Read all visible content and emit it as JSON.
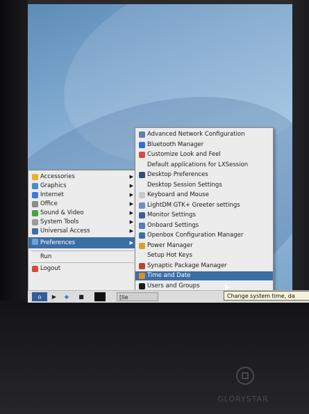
{
  "main_menu": {
    "items": [
      {
        "label": "Accessories",
        "icon": "accessories-icon",
        "color": "#e6b41e",
        "arrow": "▶"
      },
      {
        "label": "Graphics",
        "icon": "graphics-icon",
        "color": "#4b8bd1",
        "arrow": "▶"
      },
      {
        "label": "Internet",
        "icon": "internet-icon",
        "color": "#3a7bd5",
        "arrow": "▶"
      },
      {
        "label": "Office",
        "icon": "office-icon",
        "color": "#8a8a8a",
        "arrow": "▶"
      },
      {
        "label": "Sound & Video",
        "icon": "sound-video-icon",
        "color": "#4aa047",
        "arrow": "▶"
      },
      {
        "label": "System Tools",
        "icon": "system-tools-icon",
        "color": "#9a9a9a",
        "arrow": "▶"
      },
      {
        "label": "Universal Access",
        "icon": "universal-access-icon",
        "color": "#3a6ea5",
        "arrow": "▶"
      },
      {
        "label": "Preferences",
        "icon": "preferences-icon",
        "color": "#6fa0d8",
        "arrow": "▶"
      },
      {
        "label": "Run",
        "icon": "run-icon",
        "color": "#ececec",
        "arrow": ""
      },
      {
        "label": "Logout",
        "icon": "logout-icon",
        "color": "#d94a3a",
        "arrow": ""
      }
    ],
    "active_item": "Preferences"
  },
  "sub_menu": {
    "items": [
      {
        "label": "Advanced Network Configuration",
        "icon": "network-config-icon",
        "color": "#5a7fb0"
      },
      {
        "label": "Bluetooth Manager",
        "icon": "bluetooth-icon",
        "color": "#2f6fd6"
      },
      {
        "label": "Customize Look and Feel",
        "icon": "look-feel-icon",
        "color": "#d64a4a"
      },
      {
        "label": "Default applications for LXSession",
        "icon": "default-apps-icon",
        "color": "#ececec"
      },
      {
        "label": "Desktop Preferences",
        "icon": "desktop-prefs-icon",
        "color": "#2f4f7a"
      },
      {
        "label": "Desktop Session Settings",
        "icon": "session-settings-icon",
        "color": "#ececec"
      },
      {
        "label": "Keyboard and Mouse",
        "icon": "keyboard-mouse-icon",
        "color": "#c9c9c9"
      },
      {
        "label": "LightDM GTK+ Greeter settings",
        "icon": "greeter-icon",
        "color": "#6c8fbd"
      },
      {
        "label": "Monitor Settings",
        "icon": "monitor-icon",
        "color": "#3a5f95"
      },
      {
        "label": "Onboard Settings",
        "icon": "onboard-icon",
        "color": "#4d7fc0"
      },
      {
        "label": "Openbox Configuration Manager",
        "icon": "openbox-icon",
        "color": "#3a6ea5"
      },
      {
        "label": "Power Manager",
        "icon": "power-icon",
        "color": "#d8a02a"
      },
      {
        "label": "Setup Hot Keys",
        "icon": "hotkeys-icon",
        "color": "#ececec"
      },
      {
        "label": "Synaptic Package Manager",
        "icon": "synaptic-icon",
        "color": "#b3472f"
      },
      {
        "label": "Time and Date",
        "icon": "time-date-icon",
        "color": "#e08a2a"
      },
      {
        "label": "Users and Groups",
        "icon": "users-groups-icon",
        "color": "#1a1a1a"
      }
    ],
    "active_item": "Time and Date"
  },
  "taskbar": {
    "task_label": "[lie",
    "start_symbol": "⌂",
    "file_symbol": "▶",
    "desk_symbol": "◆",
    "term_symbol": "■"
  },
  "tooltip": {
    "text": "Change system time, da"
  },
  "device": {
    "brand": "GLORYSTAR"
  }
}
